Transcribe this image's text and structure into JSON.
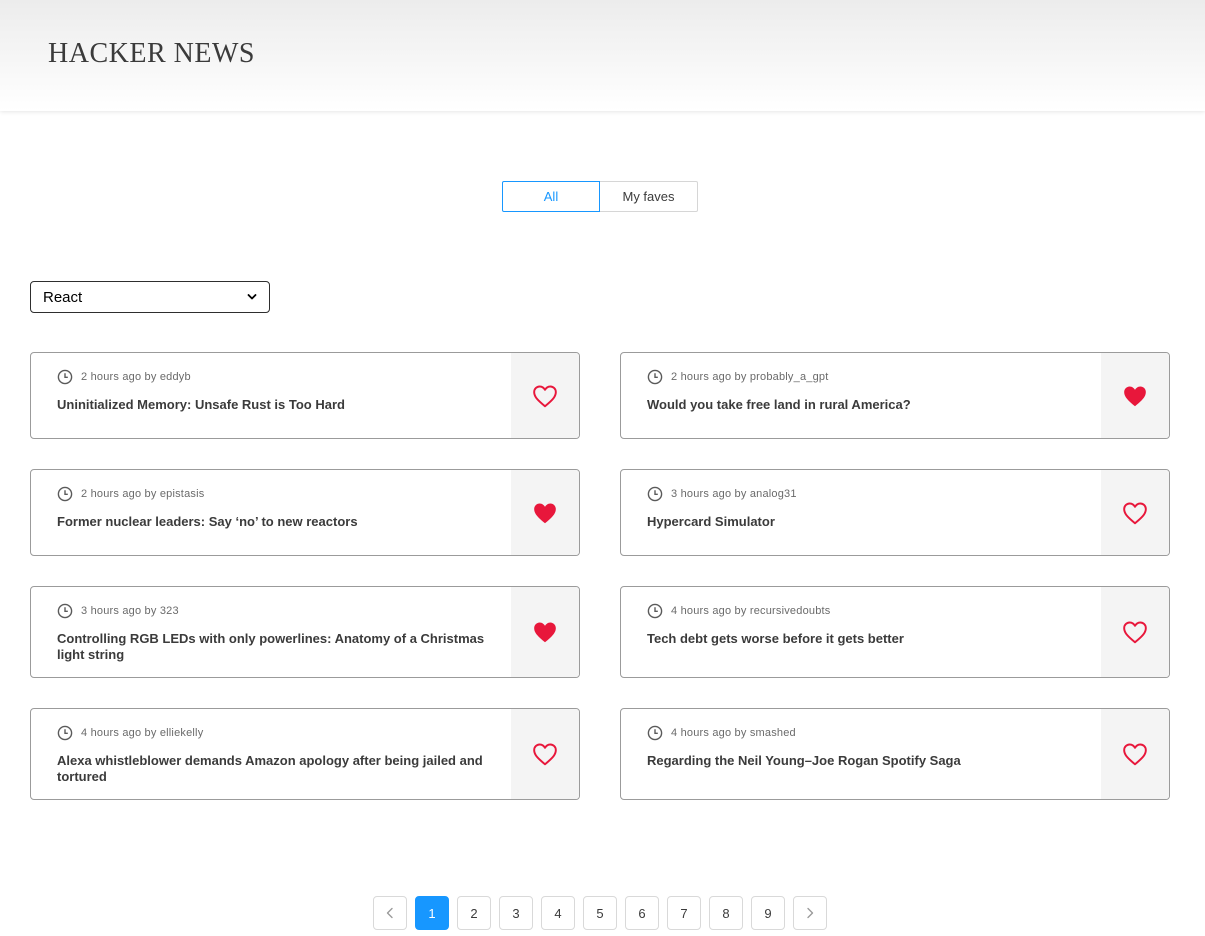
{
  "header": {
    "title": "HACKER NEWS"
  },
  "filter_tabs": {
    "all_label": "All",
    "faves_label": "My faves"
  },
  "framework_select": {
    "value": "React"
  },
  "colors": {
    "accent": "#1797ff",
    "fave_red": "#e8173b",
    "panel": "#f4f4f4"
  },
  "icons": {
    "clock": "clock-icon",
    "heart_filled": "heart-filled-icon",
    "heart_outline": "heart-outline-icon",
    "chevron": "chevron-down-icon"
  },
  "posts": [
    {
      "meta": "2 hours ago by eddyb",
      "title": "Uninitialized Memory: Unsafe Rust is Too Hard",
      "faved": false
    },
    {
      "meta": "2 hours ago by probably_a_gpt",
      "title": "Would you take free land in rural America?",
      "faved": true
    },
    {
      "meta": "2 hours ago by epistasis",
      "title": "Former nuclear leaders: Say ‘no’ to new reactors",
      "faved": true
    },
    {
      "meta": "3 hours ago by analog31",
      "title": "Hypercard Simulator",
      "faved": false
    },
    {
      "meta": "3 hours ago by 323",
      "title": "Controlling RGB LEDs with only powerlines: Anatomy of a Christmas light string",
      "faved": true
    },
    {
      "meta": "4 hours ago by recursivedoubts",
      "title": "Tech debt gets worse before it gets better",
      "faved": false
    },
    {
      "meta": "4 hours ago by elliekelly",
      "title": "Alexa whistleblower demands Amazon apology after being jailed and tortured",
      "faved": false
    },
    {
      "meta": "4 hours ago by smashed",
      "title": "Regarding the Neil Young–Joe Rogan Spotify Saga",
      "faved": false
    }
  ],
  "pagination": {
    "pages": [
      "1",
      "2",
      "3",
      "4",
      "5",
      "6",
      "7",
      "8",
      "9"
    ],
    "current": "1"
  }
}
